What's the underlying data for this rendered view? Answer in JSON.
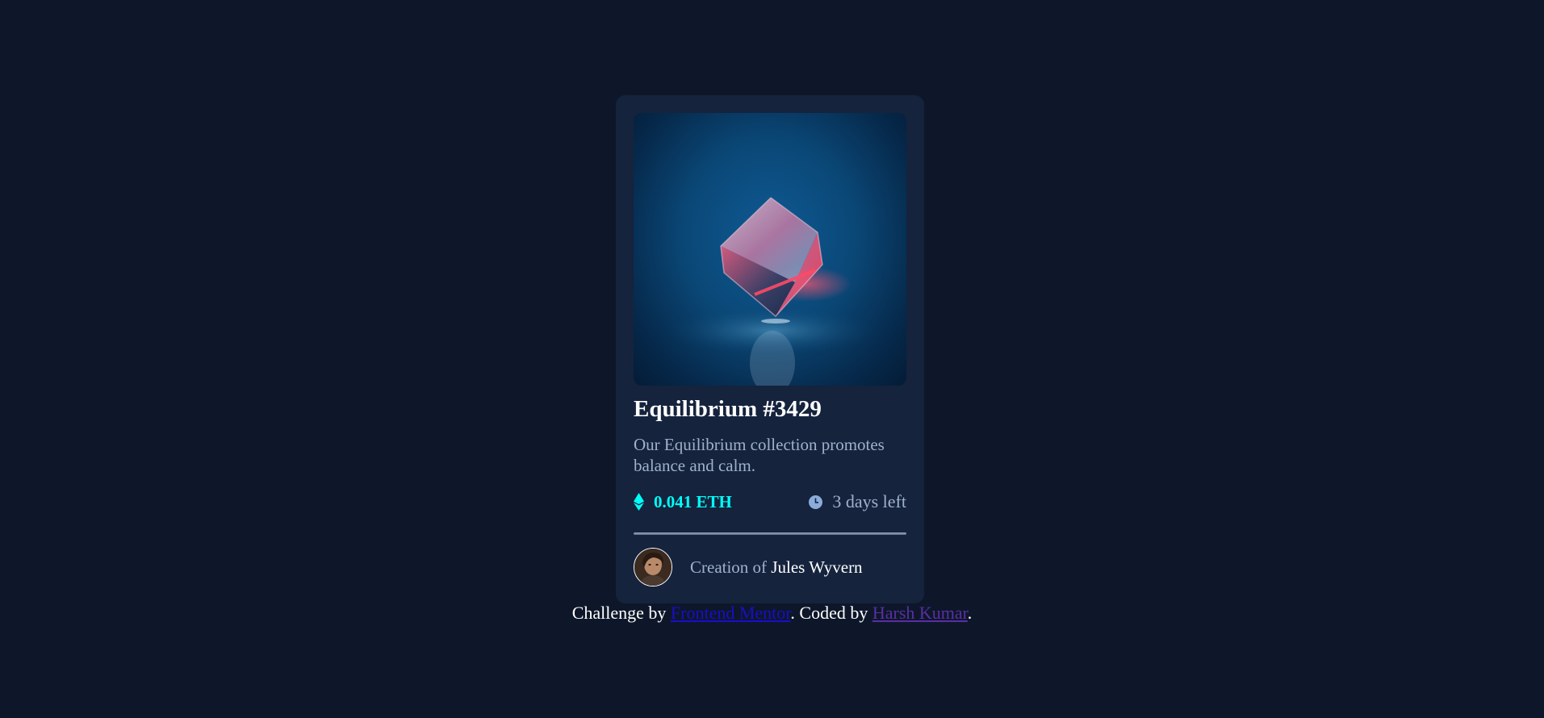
{
  "card": {
    "image_alt": "Equilibrium cube artwork",
    "title": "Equilibrium #3429",
    "description": "Our Equilibrium collection promotes balance and calm.",
    "price": "0.041 ETH",
    "time_left": "3 days left",
    "creator_prefix": "Creation of",
    "creator_name": "Jules Wyvern",
    "icons": {
      "price": "ethereum-icon",
      "time": "clock-icon"
    }
  },
  "footer": {
    "prefix": "Challenge by",
    "challenge_link": "Frontend Mentor",
    "middle": ". Coded by",
    "author_link": "Harsh Kumar",
    "suffix": "."
  },
  "colors": {
    "background": "#0d1729",
    "card": "#15233d",
    "accent_cyan": "#00fff8",
    "soft_blue": "#8bacd9",
    "white": "#ffffff"
  }
}
